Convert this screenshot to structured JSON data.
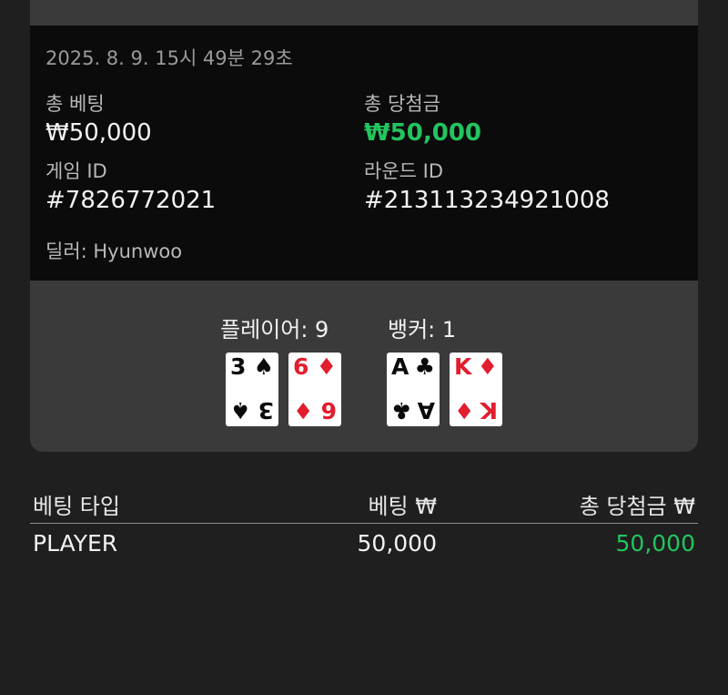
{
  "round": {
    "timestamp": "2025. 8. 9. 15시 49분 29초",
    "total_bet_label": "총 베팅",
    "total_bet_value": "₩50,000",
    "total_win_label": "총 당첨금",
    "total_win_value": "₩50,000",
    "game_id_label": "게임 ID",
    "game_id_value": "#7826772021",
    "round_id_label": "라운드 ID",
    "round_id_value": "#213113234921008",
    "dealer": "딜러: Hyunwoo"
  },
  "hands": {
    "player_label": "플레이어: 9",
    "banker_label": "뱅커: 1",
    "player_cards": [
      {
        "rank": "3",
        "suit": "♠",
        "color": "#0a0a0a"
      },
      {
        "rank": "6",
        "suit": "♦",
        "color": "#e11d2e"
      }
    ],
    "banker_cards": [
      {
        "rank": "A",
        "suit": "♣",
        "color": "#0a0a0a"
      },
      {
        "rank": "K",
        "suit": "♦",
        "color": "#e11d2e"
      }
    ]
  },
  "bets": {
    "headers": [
      "베팅 타입",
      "베팅 ₩",
      "총 당첨금 ₩"
    ],
    "rows": [
      {
        "type": "PLAYER",
        "bet": "50,000",
        "win": "50,000"
      }
    ]
  },
  "colors": {
    "win": "#22c55e",
    "panel": "#3a3a3a",
    "info_bg": "#0b0b0b",
    "page_bg": "#1f1f1f"
  }
}
